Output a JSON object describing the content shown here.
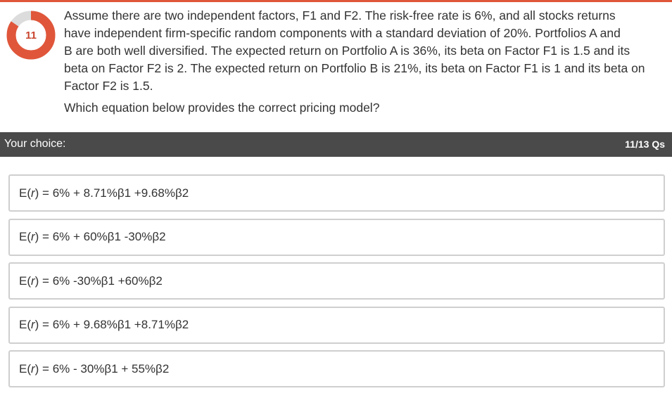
{
  "question": {
    "number": "11",
    "progress_fraction": 0.846,
    "text_lines": [
      "Assume there are two independent factors, F1 and F2. The risk-free rate is 6%, and all stocks returns",
      "have independent firm-specific random components with a standard deviation of 20%. Portfolios A and",
      "B are both well diversified. The expected return on Portfolio A is 36%, its beta on Factor F1 is 1.5 and its",
      "beta on Factor F2 is 2. The expected return on Portfolio B is 21%, its beta on Factor F1 is 1 and its beta on",
      "Factor F2 is 1.5."
    ],
    "prompt": "Which equation below provides the correct pricing model?"
  },
  "bar": {
    "label": "Your choice:",
    "counter": "11/13 Qs"
  },
  "options": [
    "E(r) = 6% + 8.71%β1 +9.68%β2",
    "E(r) = 6% + 60%β1 -30%β2",
    "E(r) = 6% -30%β1 +60%β2",
    "E(r) = 6% + 9.68%β1 +8.71%β2",
    "E(r) = 6% - 30%β1 + 55%β2"
  ],
  "colors": {
    "accent": "#e0563a",
    "ring_track": "#dcdcdc",
    "bar": "#4a4a4a"
  }
}
